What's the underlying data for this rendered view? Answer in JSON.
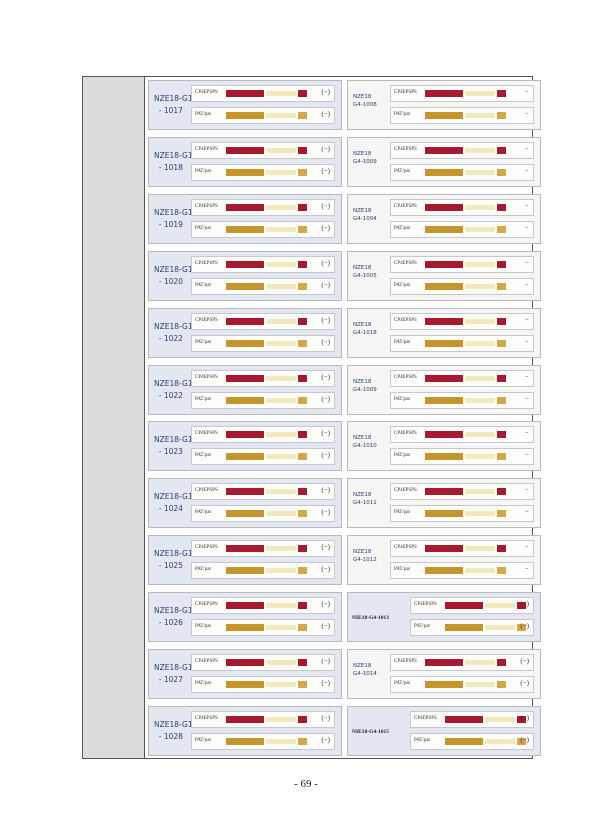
{
  "page": {
    "number": "- 69 -"
  },
  "left_cards": [
    {
      "hw": "NZE18-G1\n  - 1017",
      "top_label": "CP4EPSPS",
      "bot_label": "PAT/pat",
      "top_res": "(−)",
      "bot_res": "(−)"
    },
    {
      "hw": "NZE18-G1\n  - 1018",
      "top_label": "CP4EPSPS",
      "bot_label": "PAT/pat",
      "top_res": "(−)",
      "bot_res": "(−)"
    },
    {
      "hw": "NZE18-G1\n  - 1019",
      "top_label": "CP4EPSPS",
      "bot_label": "PAT/pat",
      "top_res": "(−)",
      "bot_res": "(−)"
    },
    {
      "hw": "NZE18-G1\n  - 1020",
      "top_label": "CP4EPSPS",
      "bot_label": "PAT/pat",
      "top_res": "(−)",
      "bot_res": "(−)"
    },
    {
      "hw": "NZE18-G1\n  - 1022",
      "top_label": "CP4EPSPS",
      "bot_label": "PAT/pat",
      "top_res": "(−)",
      "bot_res": "(−)"
    },
    {
      "hw": "NZE18-G1\n  - 1022",
      "top_label": "CP4EPSPS",
      "bot_label": "PAT/pat",
      "top_res": "(−)",
      "bot_res": "(−)"
    },
    {
      "hw": "NZE18-G1\n  - 1023",
      "top_label": "CP4EPSPS",
      "bot_label": "PAT/pat",
      "top_res": "(−)",
      "bot_res": "(−)"
    },
    {
      "hw": "NZE18-G1\n  - 1024",
      "top_label": "CP4EPSPS",
      "bot_label": "PAT/pat",
      "top_res": "(−)",
      "bot_res": "(−)"
    },
    {
      "hw": "NZE18-G1\n  - 1025",
      "top_label": "CP4EPSPS",
      "bot_label": "PAT/pat",
      "top_res": "(−)",
      "bot_res": "(−)"
    },
    {
      "hw": "NZE18-G1\n  - 1026",
      "top_label": "CP4EPSPS",
      "bot_label": "PAT/pat",
      "top_res": "(−)",
      "bot_res": "(−)"
    },
    {
      "hw": "NZE18-G1\n  - 1027",
      "top_label": "CP4EPSPS",
      "bot_label": "PAT/pat",
      "top_res": "(−)",
      "bot_res": "(−)"
    },
    {
      "hw": "NZE18-G1\n  - 1028",
      "top_label": "CP4EPSPS",
      "bot_label": "PAT/pat",
      "top_res": "(−)",
      "bot_res": "(−)"
    }
  ],
  "right_cards": [
    {
      "hw": "NZE18\nG4-1008",
      "top_label": "CP4EPSPS",
      "bot_label": "PAT/pat",
      "top_res": "−",
      "bot_res": "−"
    },
    {
      "hw": "NZE18\nG4-1009",
      "top_label": "CP4EPSPS",
      "bot_label": "PAT/pat",
      "top_res": "−",
      "bot_res": "−"
    },
    {
      "hw": "NZE18\nG4-1004",
      "top_label": "CP4EPSPS",
      "bot_label": "PAT/pat",
      "top_res": "−",
      "bot_res": "−"
    },
    {
      "hw": "NZE18\nG4-1005",
      "top_label": "CP4EPSPS",
      "bot_label": "PAT/pat",
      "top_res": "−",
      "bot_res": "−"
    },
    {
      "hw": "NZE18\nG4-1018",
      "top_label": "CP4EPSPS",
      "bot_label": "PAT/pat",
      "top_res": "−",
      "bot_res": "−"
    },
    {
      "hw": "NZE18\nG4-1009",
      "top_label": "CP4EPSPS",
      "bot_label": "PAT/pat",
      "top_res": "−",
      "bot_res": "−"
    },
    {
      "hw": "NZE18\nG4-1010",
      "top_label": "CP4EPSPS",
      "bot_label": "PAT/pat",
      "top_res": "−",
      "bot_res": "−"
    },
    {
      "hw": "NZE18\nG4-1011",
      "top_label": "CP4EPSPS",
      "bot_label": "PAT/pat",
      "top_res": "−",
      "bot_res": "−"
    },
    {
      "hw": "NZE18\nG4-1012",
      "top_label": "CP4EPSPS",
      "bot_label": "PAT/pat",
      "top_res": "−",
      "bot_res": "−"
    },
    {
      "typed": "NIE18-G4-1013",
      "top_label": "CP4EPSPS",
      "bot_label": "PAT/pat",
      "top_res": "(−)",
      "bot_res": "(−)"
    },
    {
      "hw": "NZE18\nG4-1014",
      "top_label": "CP4EPSPS",
      "bot_label": "PAT/pat",
      "top_res": "(−)",
      "bot_res": "(−)"
    },
    {
      "typed": "NIE18-G4-1015",
      "top_label": "CP4EPSPS",
      "bot_label": "PAT/pat",
      "top_res": "(−)",
      "bot_res": "(−)"
    }
  ]
}
